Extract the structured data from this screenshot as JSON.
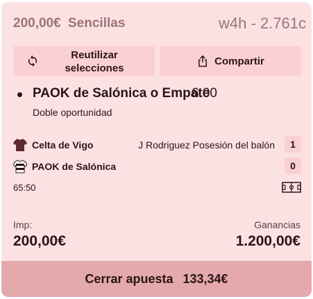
{
  "header": {
    "stake": "200,00€",
    "bet_type": "Sencillas",
    "code": "w4h - 2.761c"
  },
  "actions": {
    "reuse_label": "Reutilizar selecciones",
    "share_label": "Compartir"
  },
  "selection": {
    "name": "PAOK de Salónica o Empate",
    "odds": "6.00",
    "market": "Doble oportunidad"
  },
  "match": {
    "teams": [
      {
        "name": "Celta de Vigo",
        "stat": "J Rodriguez Posesión del balón",
        "score": "1",
        "icon": "jersey-icon"
      },
      {
        "name": "PAOK de Salónica",
        "stat": "",
        "score": "0",
        "icon": "jersey-icon"
      }
    ],
    "clock": "65:50"
  },
  "totals": {
    "stake_label": "Imp:",
    "stake_value": "200,00€",
    "winnings_label": "Ganancias",
    "winnings_value": "1.200,00€"
  },
  "cashout": {
    "label": "Cerrar apuesta",
    "amount": "133,34€"
  },
  "colors": {
    "card_bg": "#fce1e3",
    "button_bg": "#fbd0d4",
    "cashout_bg": "#e4a9ad",
    "text": "#2b1416",
    "muted": "#9b7478"
  }
}
